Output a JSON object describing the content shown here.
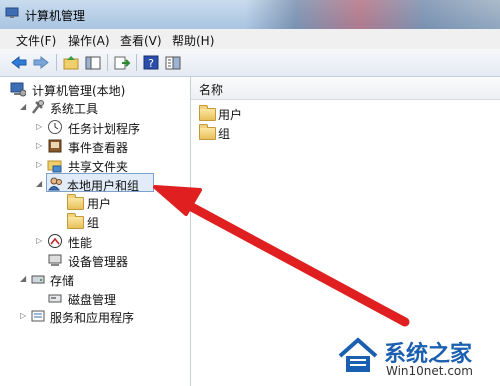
{
  "window": {
    "title": "计算机管理"
  },
  "menu": [
    {
      "label": "文件(F)"
    },
    {
      "label": "操作(A)"
    },
    {
      "label": "查看(V)"
    },
    {
      "label": "帮助(H)"
    }
  ],
  "tree": {
    "root": "计算机管理(本地)",
    "system_tools": "系统工具",
    "task_scheduler": "任务计划程序",
    "event_viewer": "事件查看器",
    "shared_folders": "共享文件夹",
    "local_users_groups": "本地用户和组",
    "users": "用户",
    "groups": "组",
    "performance": "性能",
    "device_manager": "设备管理器",
    "storage": "存储",
    "disk_management": "磁盘管理",
    "services_apps": "服务和应用程序"
  },
  "content": {
    "column_name": "名称",
    "items": [
      {
        "label": "用户"
      },
      {
        "label": "组"
      }
    ]
  },
  "watermark": {
    "brand": "系统之家",
    "url": "Win10net.com"
  },
  "colors": {
    "arrow": "#e02020",
    "selection": "#e2ecf8",
    "brand": "#1b5fb0"
  }
}
